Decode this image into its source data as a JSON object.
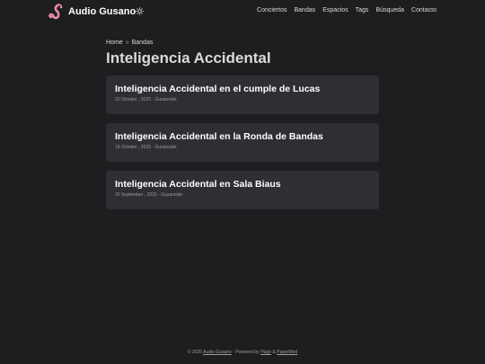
{
  "site": {
    "logo_icon": "worm-icon",
    "title": "Audio Gusano",
    "theme_icon": "sun-icon"
  },
  "menu": [
    {
      "label": "Conciertos"
    },
    {
      "label": "Bandas"
    },
    {
      "label": "Espacios"
    },
    {
      "label": "Tags"
    },
    {
      "label": "Búsqueda"
    },
    {
      "label": "Contacto"
    }
  ],
  "breadcrumb": {
    "home": "Home",
    "separator": "»",
    "section": "Bandas"
  },
  "page": {
    "title": "Inteligencia Accidental"
  },
  "posts": [
    {
      "title": "Inteligencia Accidental en el cumple de Lucas",
      "meta": "20 October , 2025 · Gusanoide"
    },
    {
      "title": "Inteligencia Accidental en la Ronda de Bandas",
      "meta": "18 October , 2025 · Gusanoide"
    },
    {
      "title": "Inteligencia Accidental en Sala Biaus",
      "meta": "20 September , 2025 · Gusanoide"
    }
  ],
  "footer": {
    "copyright": "© 2025",
    "site_link": "Audio Gusano",
    "powered_by": "· Powered by",
    "hugo": "Hugo",
    "amp": "&",
    "papermod": "PaperMod"
  },
  "colors": {
    "background": "#1d1e20",
    "card": "#2e2e33",
    "logo_pink": "#e88aa8"
  }
}
